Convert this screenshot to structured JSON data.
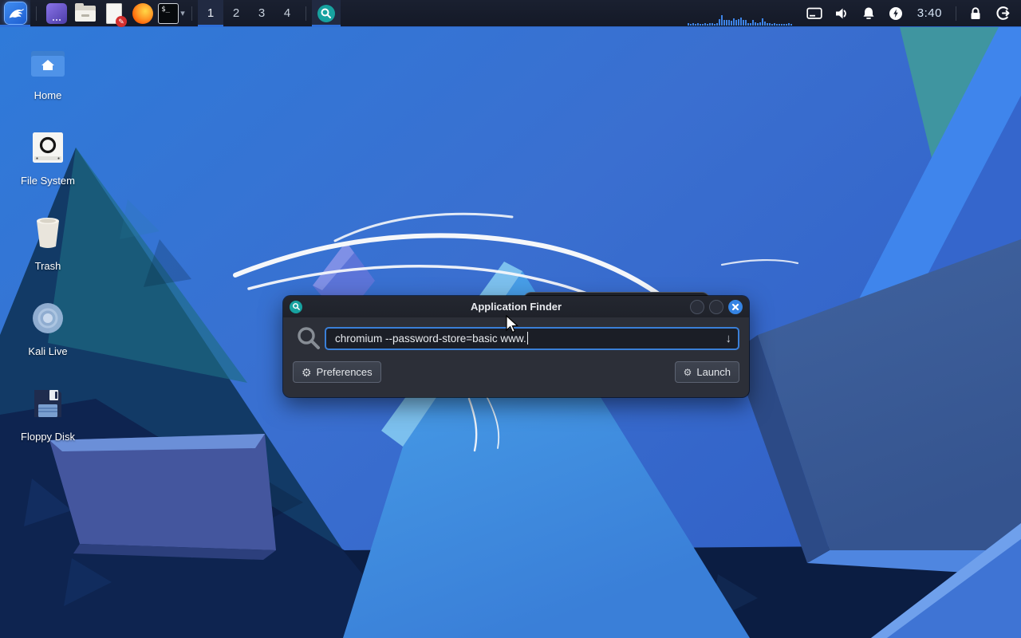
{
  "panel": {
    "workspaces": {
      "items": [
        "1",
        "2",
        "3",
        "4"
      ],
      "active": "1"
    },
    "terminal_prompt": "$_",
    "clock": "3:40",
    "cpu_graph": {
      "bars": [
        2,
        1.5,
        2,
        1.5,
        2,
        1.5,
        1.5,
        2,
        1.5,
        2,
        2.5,
        1.5,
        2,
        7,
        11,
        6,
        5.5,
        6,
        5,
        7.5,
        6,
        7,
        9,
        6,
        5.5,
        2,
        2.5,
        6,
        3,
        2,
        3.5,
        8,
        4.5,
        2.5,
        2,
        1.5,
        2,
        1.5,
        1.5,
        1,
        1.5,
        1,
        2,
        1
      ]
    }
  },
  "desktop": {
    "items": [
      {
        "label": "Home"
      },
      {
        "label": "File System"
      },
      {
        "label": "Trash"
      },
      {
        "label": "Kali Live"
      },
      {
        "label": "Floppy Disk"
      }
    ]
  },
  "finder": {
    "title": "Application Finder",
    "query": "chromium --password-store=basic www.",
    "dropdown_glyph": "↓",
    "preferences_label": "Preferences",
    "launch_label": "Launch",
    "gear_glyph": "⚙"
  },
  "colors": {
    "accent_blue": "#3584e4",
    "panel_bg": "#161b29",
    "active_underline": "#2f6fd8",
    "finder_teal": "#17a2a0",
    "dialog_bg": "#2c2f38",
    "input_bg": "#1b1e26",
    "wallpaper_main": "#3571d2",
    "wallpaper_dark": "#0c2450",
    "wallpaper_teal": "#3f95a0"
  }
}
